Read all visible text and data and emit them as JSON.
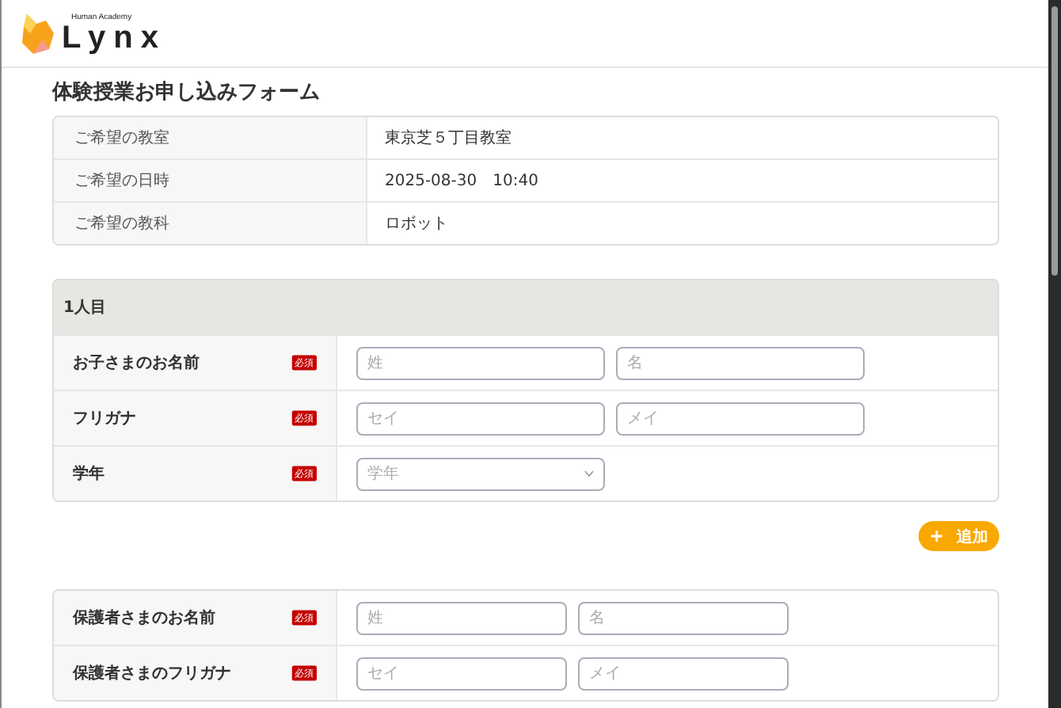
{
  "header": {
    "logo_tagline": "Human Academy",
    "logo_text": "Lynx"
  },
  "title": "体験授業お申し込みフォーム",
  "summary": [
    {
      "label": "ご希望の教室",
      "value": "東京芝５丁目教室"
    },
    {
      "label": "ご希望の日時",
      "value": "2025-08-30　10:40"
    },
    {
      "label": "ご希望の教科",
      "value": "ロボット"
    }
  ],
  "child_section": {
    "heading": "1人目",
    "fields": [
      {
        "label": "お子さまのお名前",
        "required": true,
        "badge": "必須",
        "kind": "text",
        "inputs": [
          {
            "placeholder": "姓"
          },
          {
            "placeholder": "名"
          }
        ]
      },
      {
        "label": "フリガナ",
        "required": true,
        "badge": "必須",
        "kind": "text",
        "inputs": [
          {
            "placeholder": "セイ"
          },
          {
            "placeholder": "メイ"
          }
        ]
      },
      {
        "label": "学年",
        "required": true,
        "badge": "必須",
        "kind": "select",
        "inputs": [
          {
            "placeholder": "学年"
          }
        ]
      }
    ]
  },
  "add_button": {
    "label": "追加"
  },
  "guardian_section": {
    "fields": [
      {
        "label": "保護者さまのお名前",
        "required": true,
        "badge": "必須",
        "kind": "text",
        "inputs": [
          {
            "placeholder": "姓"
          },
          {
            "placeholder": "名"
          }
        ]
      },
      {
        "label": "保護者さまのフリガナ",
        "required": true,
        "badge": "必須",
        "kind": "text",
        "inputs": [
          {
            "placeholder": "セイ"
          },
          {
            "placeholder": "メイ"
          }
        ]
      }
    ]
  }
}
